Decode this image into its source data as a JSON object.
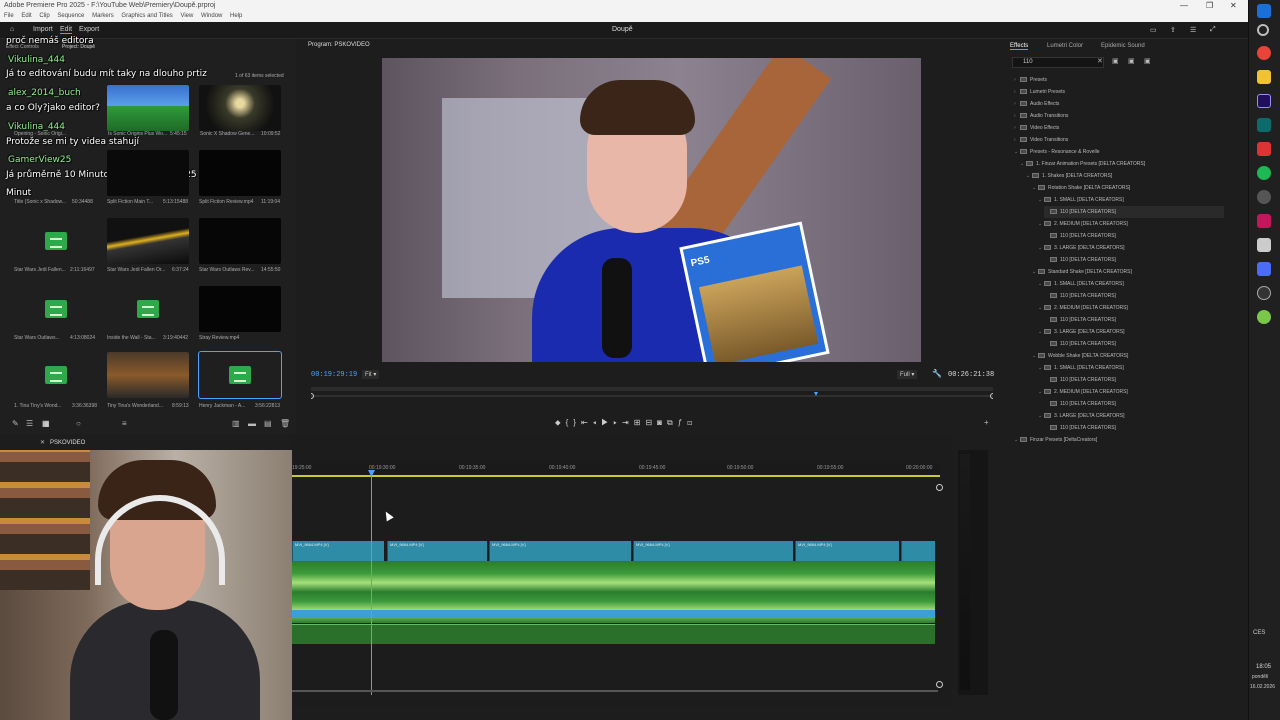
{
  "window": {
    "title": "Adobe Premiere Pro 2025 - F:\\YouTube Web\\Premiery\\Doupě.prproj",
    "workspace_title": "Doupě",
    "menu": [
      "File",
      "Edit",
      "Clip",
      "Sequence",
      "Markers",
      "Graphics and Titles",
      "View",
      "Window",
      "Help"
    ],
    "header_buttons": [
      "Import",
      "Edit",
      "Export"
    ]
  },
  "project_panel": {
    "tabs": [
      "Effect Controls",
      "Project: Doupě"
    ],
    "items_selected": "1 of 63 items selected",
    "chat": [
      {
        "name": "",
        "text": "proč nemáš editora"
      },
      {
        "name": "Vikulina_444",
        "text": ""
      },
      {
        "name": "",
        "text": "Já to editování budu mít taky na dlouho prtiz"
      },
      {
        "name": "alex_2014_buch",
        "text": ""
      },
      {
        "name": "",
        "text": "a co Oly?jako editor?"
      },
      {
        "name": "Vikulina_444",
        "text": ""
      },
      {
        "name": "",
        "text": "Protože se mi ty videa stahují"
      },
      {
        "name": "GamerView25",
        "text": ""
      },
      {
        "name": "",
        "text": "Já průměrně 10 Minutové Video Edituju 25"
      },
      {
        "name": "",
        "text": "Minut"
      }
    ],
    "items": [
      {
        "label": "Opening - Sonic Origi...",
        "dur": "1:37:4796",
        "kind": "video"
      },
      {
        "label": "Is Sonic Origins Plus Wo...",
        "dur": "5:45:15",
        "kind": "video"
      },
      {
        "label": "Sonic X Shadow Gene...",
        "dur": "10:09:52",
        "kind": "video"
      },
      {
        "label": "Title (Sonic x Shadow...",
        "dur": "50:34488",
        "kind": "audio"
      },
      {
        "label": "Split Fiction Main T...",
        "dur": "5:13:15488",
        "kind": "audio"
      },
      {
        "label": "Split Fiction Review.mp4",
        "dur": "11:19:04",
        "kind": "video"
      },
      {
        "label": "Star Wars Jedi Fallen...",
        "dur": "2:11:16497",
        "kind": "audio"
      },
      {
        "label": "Star Wars Jedi Fallen Or...",
        "dur": "6:37:24",
        "kind": "video"
      },
      {
        "label": "Star Wars Outlaws Rev...",
        "dur": "14:55:50",
        "kind": "video"
      },
      {
        "label": "Star Wars Outlaws...",
        "dur": "4:13:08024",
        "kind": "audio"
      },
      {
        "label": "Inside the Wall - Sta...",
        "dur": "3:19:40442",
        "kind": "audio"
      },
      {
        "label": "Stray Review.mp4",
        "dur": "",
        "kind": "video"
      },
      {
        "label": "1. Tina Tiny's Wond...",
        "dur": "3:36:36398",
        "kind": "audio"
      },
      {
        "label": "Tiny Tina's Wonderland...",
        "dur": "8:59:13",
        "kind": "video"
      },
      {
        "label": "Henry Jackman - A...",
        "dur": "3:56:22813",
        "kind": "audio"
      }
    ]
  },
  "program_monitor": {
    "tab": "Program: PSKOVIDEO",
    "timecode_current": "00:19:29:19",
    "zoom": "Fit",
    "quality": "Full",
    "timecode_total": "00:26:21:38"
  },
  "effects_panel": {
    "tabs": [
      "Effects",
      "Lumetri Color",
      "Epidemic Sound"
    ],
    "search_value": "110",
    "tree": [
      {
        "label": "Presets",
        "depth": 0,
        "folder": true
      },
      {
        "label": "Lumetri Presets",
        "depth": 0,
        "folder": true
      },
      {
        "label": "Audio Effects",
        "depth": 0,
        "folder": true
      },
      {
        "label": "Audio Transitions",
        "depth": 0,
        "folder": true
      },
      {
        "label": "Video Effects",
        "depth": 0,
        "folder": true
      },
      {
        "label": "Video Transitions",
        "depth": 0,
        "folder": true
      },
      {
        "label": "Presets - Resonance & Rovelle",
        "depth": 0,
        "folder": true
      },
      {
        "label": "1. Finzar Animation Presets [DELTA CREATORS]",
        "depth": 1,
        "folder": true
      },
      {
        "label": "1. Shakes [DELTA CREATORS]",
        "depth": 2,
        "folder": true
      },
      {
        "label": "Rotation Shake [DELTA CREATORS]",
        "depth": 3,
        "folder": true
      },
      {
        "label": "1. SMALL [DELTA CREATORS]",
        "depth": 4,
        "folder": true
      },
      {
        "label": "110 [DELTA CREATORS]",
        "depth": 5,
        "folder": false
      },
      {
        "label": "2. MEDIUM [DELTA CREATORS]",
        "depth": 4,
        "folder": true
      },
      {
        "label": "110 [DELTA CREATORS]",
        "depth": 5,
        "folder": false
      },
      {
        "label": "3. LARGE [DELTA CREATORS]",
        "depth": 4,
        "folder": true
      },
      {
        "label": "110 [DELTA CREATORS]",
        "depth": 5,
        "folder": false
      },
      {
        "label": "Standard Shake [DELTA CREATORS]",
        "depth": 3,
        "folder": true
      },
      {
        "label": "1. SMALL [DELTA CREATORS]",
        "depth": 4,
        "folder": true
      },
      {
        "label": "110 [DELTA CREATORS]",
        "depth": 5,
        "folder": false
      },
      {
        "label": "2. MEDIUM [DELTA CREATORS]",
        "depth": 4,
        "folder": true
      },
      {
        "label": "110 [DELTA CREATORS]",
        "depth": 5,
        "folder": false
      },
      {
        "label": "3. LARGE [DELTA CREATORS]",
        "depth": 4,
        "folder": true
      },
      {
        "label": "110 [DELTA CREATORS]",
        "depth": 5,
        "folder": false
      },
      {
        "label": "Wobble Shake [DELTA CREATORS]",
        "depth": 3,
        "folder": true
      },
      {
        "label": "1. SMALL [DELTA CREATORS]",
        "depth": 4,
        "folder": true
      },
      {
        "label": "110 [DELTA CREATORS]",
        "depth": 5,
        "folder": false
      },
      {
        "label": "2. MEDIUM [DELTA CREATORS]",
        "depth": 4,
        "folder": true
      },
      {
        "label": "110 [DELTA CREATORS]",
        "depth": 5,
        "folder": false
      },
      {
        "label": "3. LARGE [DELTA CREATORS]",
        "depth": 4,
        "folder": true
      },
      {
        "label": "110 [DELTA CREATORS]",
        "depth": 5,
        "folder": false
      },
      {
        "label": "Finzar Presets [DeltaCreators]",
        "depth": 0,
        "folder": true
      }
    ]
  },
  "timeline": {
    "sequence_tab": "PSKOVIDEO",
    "ruler": [
      "19:25:00",
      "00:19:30:00",
      "00:19:35:00",
      "00:19:40:00",
      "00:19:45:00",
      "00:19:50:00",
      "00:19:55:00",
      "00:20:00:00"
    ],
    "clip_name": "MVI_9664.MP4 [V]"
  },
  "taskbar": {
    "time": "18:05",
    "day": "pondělí",
    "date": "16.02.2026",
    "lang": "CES"
  },
  "colors": {
    "accent_blue": "#4aa3ff",
    "clip_blue": "#2e8ca6",
    "audio_green": "#2a7d2e",
    "chat_name": "#8df08a"
  }
}
